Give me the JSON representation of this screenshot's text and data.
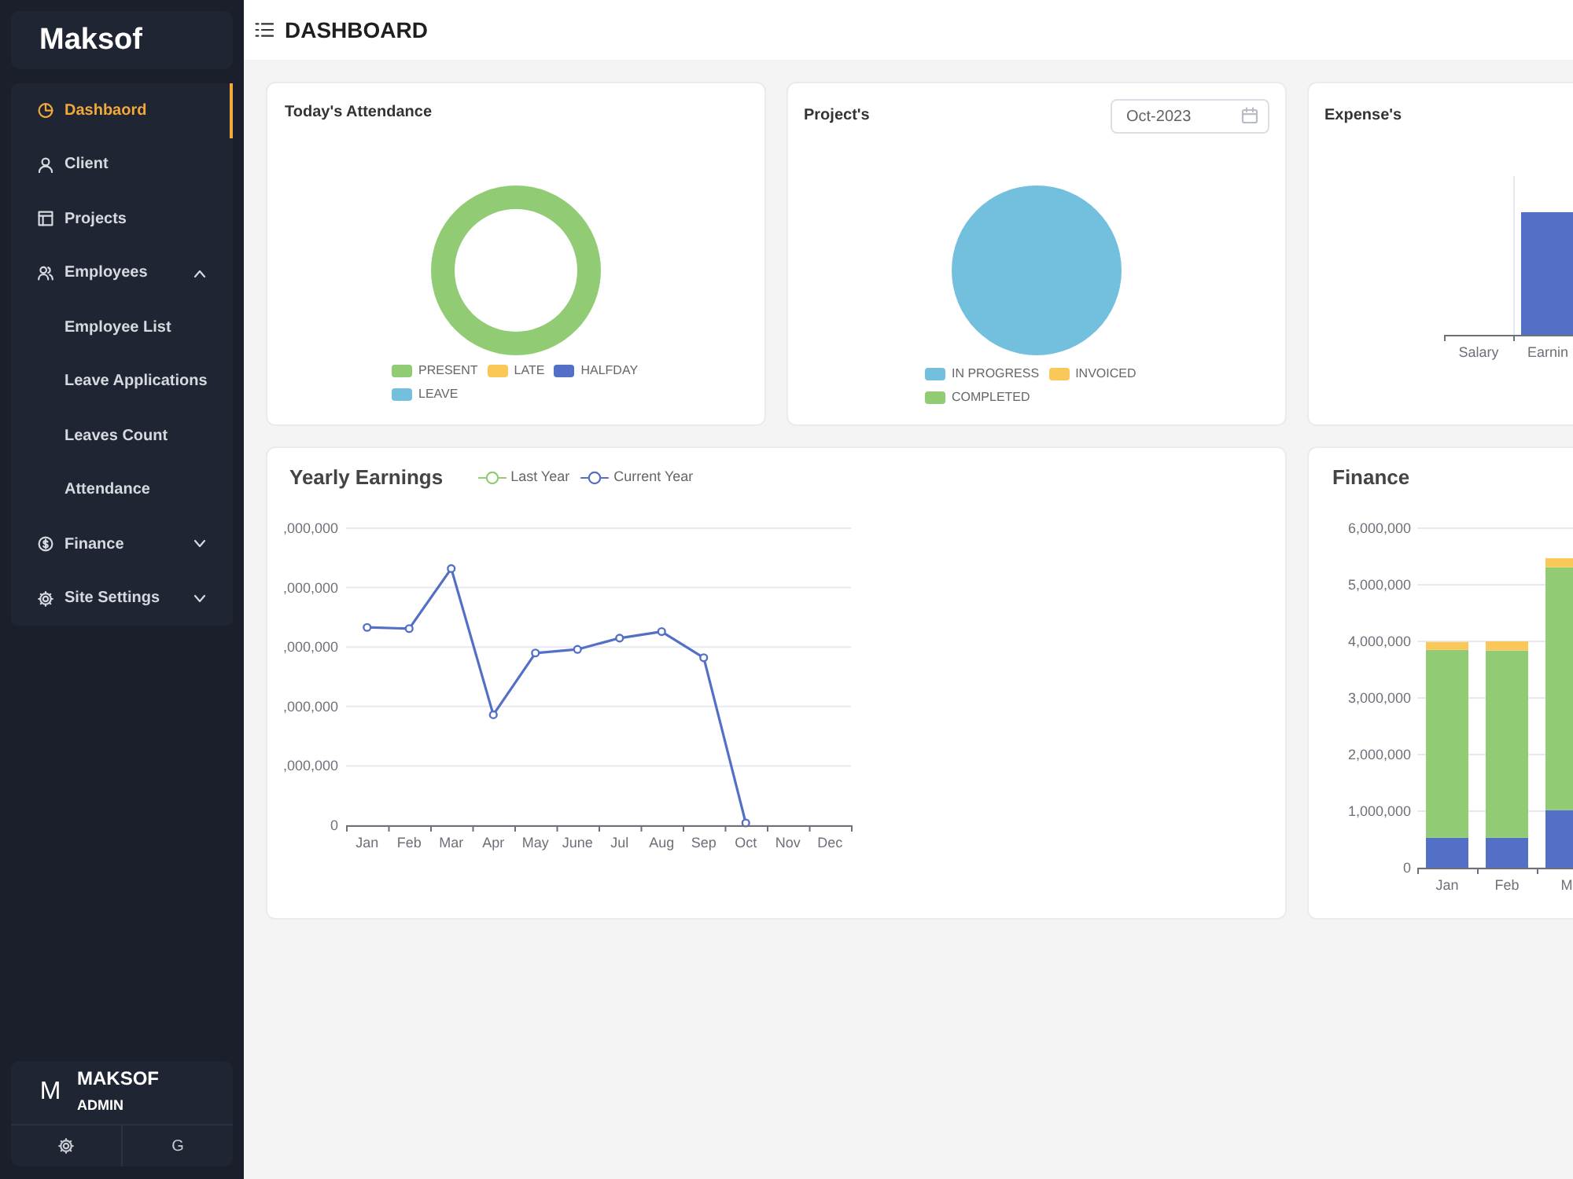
{
  "sidebar": {
    "brand": "Maksof",
    "items": [
      {
        "kind": "link",
        "label": "Dashbaord",
        "selected": true
      },
      {
        "kind": "link",
        "label": "Client",
        "selected": false
      },
      {
        "kind": "link",
        "label": "Projects",
        "selected": false
      },
      {
        "kind": "group",
        "label": "Employees",
        "selected": false,
        "expanded": true,
        "children": [
          {
            "label": "Employee List",
            "selected": false
          },
          {
            "label": "Leave Applications",
            "selected": false
          },
          {
            "label": "Leaves Count",
            "selected": false
          },
          {
            "label": "Attendance",
            "selected": false
          }
        ]
      },
      {
        "kind": "group",
        "label": "Finance",
        "selected": false,
        "expanded": false
      },
      {
        "kind": "group",
        "label": "Site Settings",
        "selected": false,
        "expanded": false
      }
    ]
  },
  "user": {
    "initial": "M",
    "name": "MAKSOF",
    "role": "ADMIN",
    "buttons": [
      {
        "kind": "icon"
      },
      {
        "kind": "text",
        "label": "G"
      }
    ]
  },
  "header": {
    "title": "DASHBOARD"
  },
  "attendance": {
    "title": "Today's Attendance",
    "legend": [
      {
        "label": "PRESENT",
        "color": "#91cc75"
      },
      {
        "label": "LATE",
        "color": "#fac858"
      },
      {
        "label": "HALFDAY",
        "color": "#5470c6"
      },
      {
        "label": "LEAVE",
        "color": "#73c0de"
      }
    ]
  },
  "projects": {
    "title": "Project's",
    "month_field": {
      "value": "Oct-2023"
    },
    "legend": [
      {
        "label": "IN PROGRESS",
        "color": "#73c0de"
      },
      {
        "label": "INVOICED",
        "color": "#fac858"
      },
      {
        "label": "COMPLETED",
        "color": "#91cc75"
      }
    ]
  },
  "expenses": {
    "title": "Expense's",
    "x_labels": [
      "Salary",
      "Earnin"
    ]
  },
  "yearly_earnings": {
    "title": "Yearly Earnings",
    "legend": [
      {
        "label": "Last Year",
        "color": "#91cc75"
      },
      {
        "label": "Current Year",
        "color": "#5470c6"
      }
    ],
    "y_axis_labels": [
      ",000,000",
      ",000,000",
      ",000,000",
      ",000,000",
      ",000,000",
      "0"
    ],
    "x_axis_labels": [
      "Jan",
      "Feb",
      "Mar",
      "Apr",
      "May",
      "June",
      "Jul",
      "Aug",
      "Sep",
      "Oct",
      "Nov",
      "Dec"
    ]
  },
  "finance": {
    "title": "Finance",
    "chart_data": {
      "type": "bar",
      "stacked": true,
      "grid": true,
      "categories": [
        "Jan",
        "Feb",
        "M"
      ],
      "series": [
        {
          "color": "#5470c6",
          "values": [
            530000,
            530000,
            1020000
          ]
        },
        {
          "color": "#91cc75",
          "values": [
            3320000,
            3310000,
            4290000
          ]
        },
        {
          "color": "#fac858",
          "values": [
            140000,
            160000,
            160000
          ]
        }
      ],
      "ylim": [
        0,
        6000000
      ],
      "yticks": [
        0,
        {
          "value": 1000000,
          "label": "1,000,000"
        },
        {
          "value": 2000000,
          "label": "2,000,000"
        },
        {
          "value": 3000000,
          "label": "3,000,000"
        },
        {
          "value": 4000000,
          "label": "4,000,000"
        },
        {
          "value": 5000000,
          "label": "5,000,000"
        },
        {
          "value": 6000000,
          "label": "6,000,000"
        }
      ]
    }
  }
}
